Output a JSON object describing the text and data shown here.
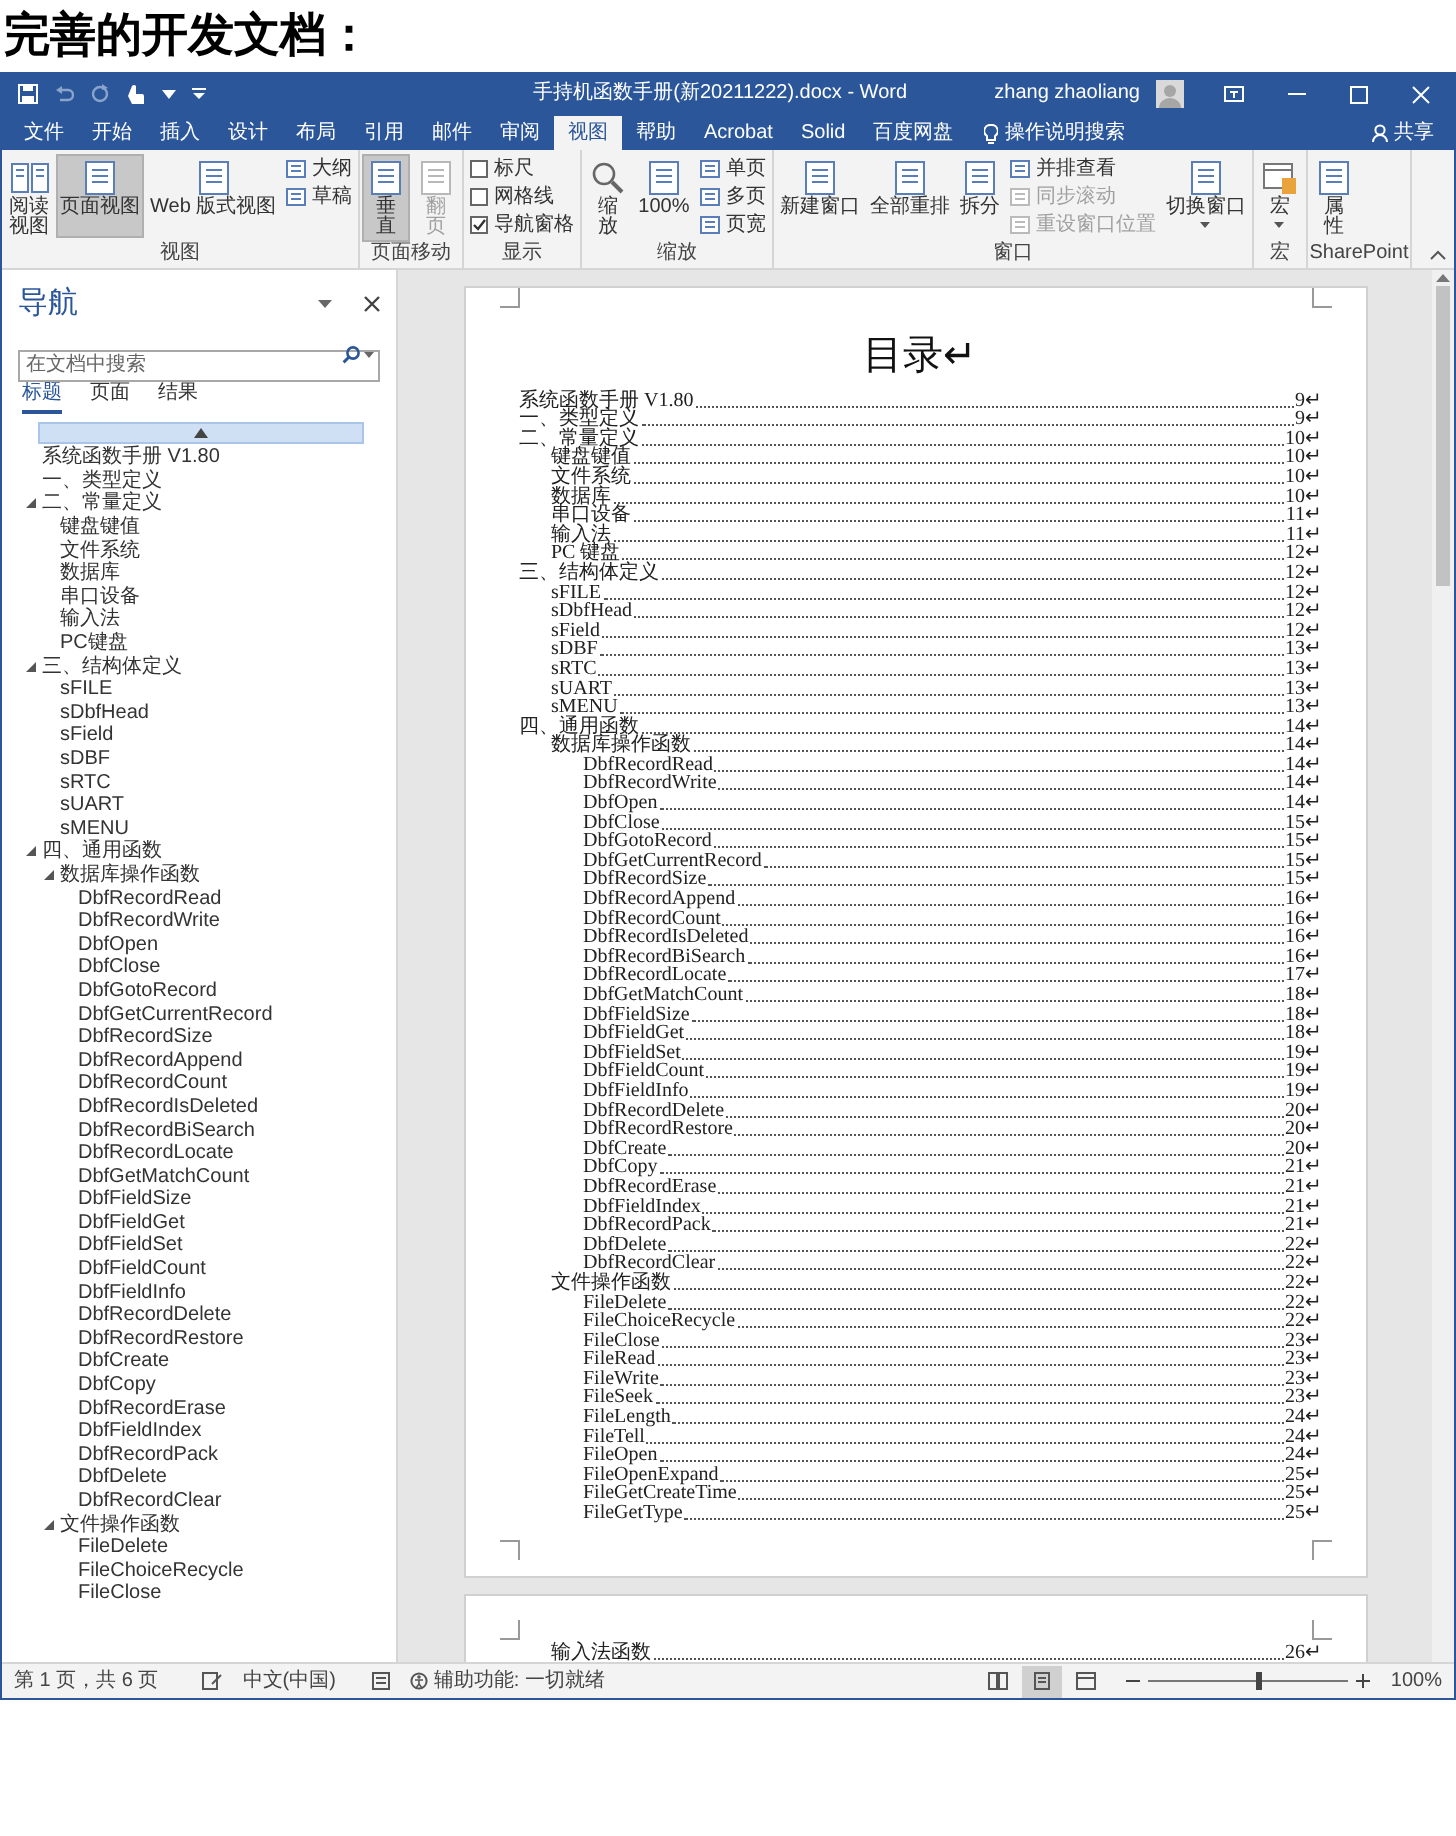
{
  "heading": "完善的开发文档：",
  "window": {
    "title": "手持机函数手册(新20211222).docx - Word",
    "user": "zhang zhaoliang"
  },
  "menu_tabs": [
    {
      "label": "文件",
      "selected": false
    },
    {
      "label": "开始",
      "selected": false
    },
    {
      "label": "插入",
      "selected": false
    },
    {
      "label": "设计",
      "selected": false
    },
    {
      "label": "布局",
      "selected": false
    },
    {
      "label": "引用",
      "selected": false
    },
    {
      "label": "邮件",
      "selected": false
    },
    {
      "label": "审阅",
      "selected": false
    },
    {
      "label": "视图",
      "selected": true
    },
    {
      "label": "帮助",
      "selected": false
    },
    {
      "label": "Acrobat",
      "selected": false
    },
    {
      "label": "Solid",
      "selected": false
    },
    {
      "label": "百度网盘",
      "selected": false
    }
  ],
  "tell_me": "操作说明搜索",
  "share": "共享",
  "ribbon": [
    {
      "label": "视图",
      "items": [
        {
          "kind": "stacked",
          "label": "阅读视图",
          "selected": false
        },
        {
          "kind": "large",
          "label": "页面视图",
          "selected": true
        },
        {
          "kind": "large",
          "label": "Web 版式视图",
          "selected": false
        },
        {
          "kind": "small",
          "label": "大纲"
        },
        {
          "kind": "small",
          "label": "草稿"
        }
      ]
    },
    {
      "label": "页面移动",
      "items": [
        {
          "kind": "stacked",
          "label": "垂直",
          "selected": true
        },
        {
          "kind": "stacked",
          "label": "翻页",
          "selected": false,
          "disabled": true
        }
      ]
    },
    {
      "label": "显示",
      "items": [
        {
          "kind": "check",
          "label": "标尺",
          "checked": false
        },
        {
          "kind": "check",
          "label": "网格线",
          "checked": false
        },
        {
          "kind": "check",
          "label": "导航窗格",
          "checked": true
        }
      ]
    },
    {
      "label": "缩放",
      "items": [
        {
          "kind": "stacked",
          "label": "缩放",
          "selected": false
        },
        {
          "kind": "large",
          "label": "100%",
          "selected": false
        },
        {
          "kind": "small",
          "label": "单页"
        },
        {
          "kind": "small",
          "label": "多页"
        },
        {
          "kind": "small",
          "label": "页宽"
        }
      ]
    },
    {
      "label": "窗口",
      "items": [
        {
          "kind": "large",
          "label": "新建窗口",
          "selected": false
        },
        {
          "kind": "large",
          "label": "全部重排",
          "selected": false
        },
        {
          "kind": "large",
          "label": "拆分",
          "selected": false
        },
        {
          "kind": "small",
          "label": "并排查看"
        },
        {
          "kind": "small",
          "label": "同步滚动",
          "disabled": true
        },
        {
          "kind": "small",
          "label": "重设窗口位置",
          "disabled": true
        },
        {
          "kind": "large",
          "label": "切换窗口",
          "selected": false,
          "dropdown": true
        }
      ]
    },
    {
      "label": "宏",
      "items": [
        {
          "kind": "large",
          "label": "宏",
          "selected": false,
          "dropdown": true
        }
      ]
    },
    {
      "label": "SharePoint",
      "items": [
        {
          "kind": "stacked",
          "label": "属性",
          "selected": false
        }
      ]
    }
  ],
  "navigation": {
    "title": "导航",
    "search": {
      "placeholder": "在文档中搜索"
    },
    "tabs": [
      {
        "label": "标题",
        "selected": true
      },
      {
        "label": "页面",
        "selected": false
      },
      {
        "label": "结果",
        "selected": false
      }
    ],
    "tree": [
      {
        "text": "系统函数手册 V1.80"
      },
      {
        "text": "一、类型定义"
      },
      {
        "text": "二、常量定义",
        "expanded": true,
        "children": [
          {
            "text": "键盘键值"
          },
          {
            "text": "文件系统"
          },
          {
            "text": "数据库"
          },
          {
            "text": "串口设备"
          },
          {
            "text": "输入法"
          },
          {
            "text": "PC键盘"
          }
        ]
      },
      {
        "text": "三、结构体定义",
        "expanded": true,
        "children": [
          {
            "text": "sFILE"
          },
          {
            "text": "sDbfHead"
          },
          {
            "text": "sField"
          },
          {
            "text": "sDBF"
          },
          {
            "text": "sRTC"
          },
          {
            "text": "sUART"
          },
          {
            "text": "sMENU"
          }
        ]
      },
      {
        "text": "四、通用函数",
        "expanded": true,
        "children": [
          {
            "text": "数据库操作函数",
            "expanded": true,
            "children": [
              {
                "text": "DbfRecordRead"
              },
              {
                "text": "DbfRecordWrite"
              },
              {
                "text": "DbfOpen"
              },
              {
                "text": "DbfClose"
              },
              {
                "text": "DbfGotoRecord"
              },
              {
                "text": "DbfGetCurrentRecord"
              },
              {
                "text": "DbfRecordSize"
              },
              {
                "text": "DbfRecordAppend"
              },
              {
                "text": "DbfRecordCount"
              },
              {
                "text": "DbfRecordIsDeleted"
              },
              {
                "text": "DbfRecordBiSearch"
              },
              {
                "text": "DbfRecordLocate"
              },
              {
                "text": "DbfGetMatchCount"
              },
              {
                "text": "DbfFieldSize"
              },
              {
                "text": "DbfFieldGet"
              },
              {
                "text": "DbfFieldSet"
              },
              {
                "text": "DbfFieldCount"
              },
              {
                "text": "DbfFieldInfo"
              },
              {
                "text": "DbfRecordDelete"
              },
              {
                "text": "DbfRecordRestore"
              },
              {
                "text": "DbfCreate"
              },
              {
                "text": "DbfCopy"
              },
              {
                "text": "DbfRecordErase"
              },
              {
                "text": "DbfFieldIndex"
              },
              {
                "text": "DbfRecordPack"
              },
              {
                "text": "DbfDelete"
              },
              {
                "text": "DbfRecordClear"
              }
            ]
          },
          {
            "text": "文件操作函数",
            "expanded": true,
            "children": [
              {
                "text": "FileDelete"
              },
              {
                "text": "FileChoiceRecycle"
              },
              {
                "text": "FileClose"
              }
            ]
          }
        ]
      }
    ]
  },
  "document": {
    "title": "目录↵",
    "toc": [
      {
        "text": "系统函数手册 V1.80",
        "page": "9↵"
      },
      {
        "text": "一、类型定义",
        "page": "9↵"
      },
      {
        "text": "二、常量定义",
        "page": "10↵",
        "children": [
          {
            "text": "键盘键值",
            "page": "10↵"
          },
          {
            "text": "文件系统",
            "page": "10↵"
          },
          {
            "text": "数据库",
            "page": "10↵"
          },
          {
            "text": "串口设备",
            "page": "11↵"
          },
          {
            "text": "输入法",
            "page": "11↵"
          },
          {
            "text": "PC 键盘",
            "page": "12↵"
          }
        ]
      },
      {
        "text": "三、结构体定义",
        "page": "12↵",
        "children": [
          {
            "text": "sFILE",
            "page": "12↵"
          },
          {
            "text": "sDbfHead",
            "page": "12↵"
          },
          {
            "text": "sField",
            "page": "12↵"
          },
          {
            "text": "sDBF",
            "page": "13↵"
          },
          {
            "text": "sRTC",
            "page": "13↵"
          },
          {
            "text": "sUART",
            "page": "13↵"
          },
          {
            "text": "sMENU",
            "page": "13↵"
          }
        ]
      },
      {
        "text": "四、通用函数",
        "page": "14↵",
        "children": [
          {
            "text": "数据库操作函数",
            "page": "14↵",
            "children": [
              {
                "text": "DbfRecordRead",
                "page": "14↵"
              },
              {
                "text": "DbfRecordWrite",
                "page": "14↵"
              },
              {
                "text": "DbfOpen",
                "page": "14↵"
              },
              {
                "text": "DbfClose",
                "page": "15↵"
              },
              {
                "text": "DbfGotoRecord",
                "page": "15↵"
              },
              {
                "text": "DbfGetCurrentRecord",
                "page": "15↵"
              },
              {
                "text": "DbfRecordSize",
                "page": "15↵"
              },
              {
                "text": "DbfRecordAppend",
                "page": "16↵"
              },
              {
                "text": "DbfRecordCount",
                "page": "16↵"
              },
              {
                "text": "DbfRecordIsDeleted",
                "page": "16↵"
              },
              {
                "text": "DbfRecordBiSearch",
                "page": "16↵"
              },
              {
                "text": "DbfRecordLocate",
                "page": "17↵"
              },
              {
                "text": "DbfGetMatchCount",
                "page": "18↵"
              },
              {
                "text": "DbfFieldSize",
                "page": "18↵"
              },
              {
                "text": "DbfFieldGet",
                "page": "18↵"
              },
              {
                "text": "DbfFieldSet",
                "page": "19↵"
              },
              {
                "text": "DbfFieldCount",
                "page": "19↵"
              },
              {
                "text": "DbfFieldInfo",
                "page": "19↵"
              },
              {
                "text": "DbfRecordDelete",
                "page": "20↵"
              },
              {
                "text": "DbfRecordRestore",
                "page": "20↵"
              },
              {
                "text": "DbfCreate",
                "page": "20↵"
              },
              {
                "text": "DbfCopy",
                "page": "21↵"
              },
              {
                "text": "DbfRecordErase",
                "page": "21↵"
              },
              {
                "text": "DbfFieldIndex",
                "page": "21↵"
              },
              {
                "text": "DbfRecordPack",
                "page": "21↵"
              },
              {
                "text": "DbfDelete",
                "page": "22↵"
              },
              {
                "text": "DbfRecordClear",
                "page": "22↵"
              }
            ]
          },
          {
            "text": "文件操作函数",
            "page": "22↵",
            "children": [
              {
                "text": "FileDelete",
                "page": "22↵"
              },
              {
                "text": "FileChoiceRecycle",
                "page": "22↵"
              },
              {
                "text": "FileClose",
                "page": "23↵"
              },
              {
                "text": "FileRead",
                "page": "23↵"
              },
              {
                "text": "FileWrite",
                "page": "23↵"
              },
              {
                "text": "FileSeek",
                "page": "23↵"
              },
              {
                "text": "FileLength",
                "page": "24↵"
              },
              {
                "text": "FileTell",
                "page": "24↵"
              },
              {
                "text": "FileOpen",
                "page": "24↵"
              },
              {
                "text": "FileOpenExpand",
                "page": "25↵"
              },
              {
                "text": "FileGetCreateTime",
                "page": "25↵"
              },
              {
                "text": "FileGetType",
                "page": "25↵"
              }
            ]
          }
        ]
      }
    ],
    "next_page_toc": [
      {
        "text": "输入法函数",
        "page": "26↵"
      }
    ]
  },
  "status_bar": {
    "page": "第 1 页，共 6 页",
    "language": "中文(中国)",
    "accessibility": "辅助功能: 一切就绪",
    "views": [
      {
        "selected": false
      },
      {
        "selected": true
      },
      {
        "selected": false
      }
    ],
    "zoom": {
      "level": 0.55
    },
    "zoom_percent": "100%"
  }
}
